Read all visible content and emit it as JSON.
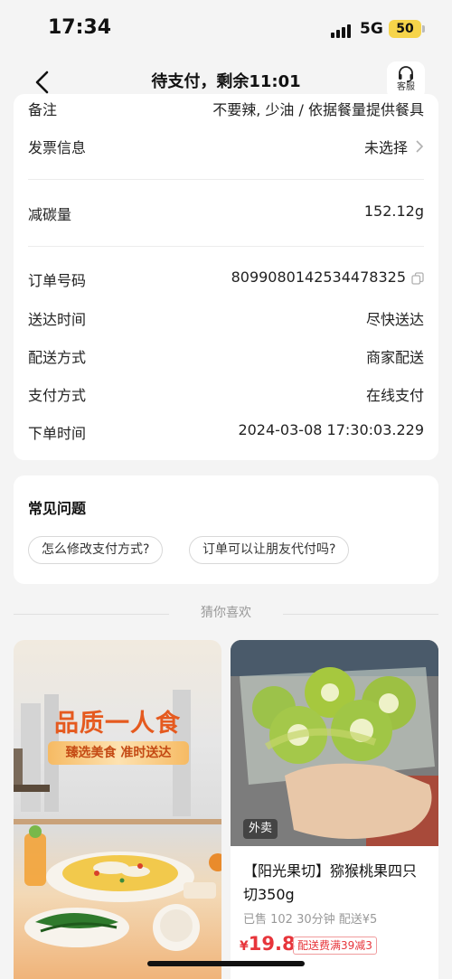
{
  "status_bar": {
    "time": "17:34",
    "network": "5G",
    "battery": "50"
  },
  "nav": {
    "title": "待支付，剩余11:01",
    "service_label": "客服"
  },
  "order_info": {
    "remark_label": "备注",
    "remark_value": "不要辣, 少油 / 依据餐量提供餐具",
    "invoice_label": "发票信息",
    "invoice_value": "未选择",
    "carbon_label": "减碳量",
    "carbon_value": "152.12g",
    "order_no_label": "订单号码",
    "order_no_value": "8099080142534478325",
    "delivery_time_label": "送达时间",
    "delivery_time_value": "尽快送达",
    "delivery_method_label": "配送方式",
    "delivery_method_value": "商家配送",
    "payment_method_label": "支付方式",
    "payment_method_value": "在线支付",
    "order_time_label": "下单时间",
    "order_time_value": "2024-03-08 17:30:03.229"
  },
  "faq": {
    "title": "常见问题",
    "q1": "怎么修改支付方式?",
    "q2": "订单可以让朋友代付吗?"
  },
  "recommend": {
    "title": "猜你喜欢",
    "promo_title": "品质一人食",
    "promo_subtitle": "臻选美食 准时送达",
    "product": {
      "tag": "外卖",
      "name": "【阳光果切】猕猴桃果四只切350g",
      "meta": "已售 102  30分钟  配送¥5",
      "currency": "¥",
      "price": "19.8",
      "promo": "配送费满39减3"
    }
  }
}
